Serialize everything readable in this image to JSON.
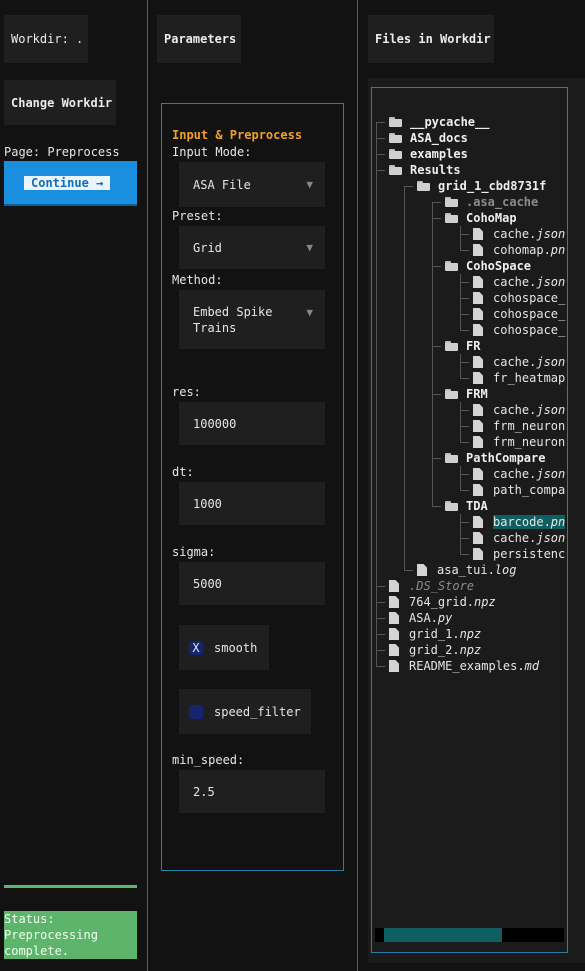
{
  "left": {
    "workdir_label": "Workdir: .",
    "change_workdir": "Change Workdir",
    "page_label": "Page: Preprocess",
    "continue_button": "Continue →",
    "status_text": "Status: Preprocessing complete."
  },
  "params": {
    "header": "Parameters",
    "section_title": "Input & Preprocess",
    "input_mode_label": "Input Mode:",
    "input_mode_value": "ASA File",
    "preset_label": "Preset:",
    "preset_value": "Grid",
    "method_label": "Method:",
    "method_value": "Embed Spike Trains",
    "res_label": "res:",
    "res_value": "100000",
    "dt_label": "dt:",
    "dt_value": "1000",
    "sigma_label": "sigma:",
    "sigma_value": "5000",
    "smooth_label": "smooth",
    "smooth_mark": "X",
    "smooth_checked": true,
    "speed_filter_label": "speed_filter",
    "speed_filter_checked": false,
    "min_speed_label": "min_speed:",
    "min_speed_value": "2.5"
  },
  "files": {
    "header": "Files in Workdir",
    "tree": [
      {
        "name": "__pycache__",
        "ext": "",
        "type": "folder"
      },
      {
        "name": "ASA_docs",
        "ext": "",
        "type": "folder"
      },
      {
        "name": "examples",
        "ext": "",
        "type": "folder"
      },
      {
        "name": "Results",
        "ext": "",
        "type": "folder"
      },
      {
        "name": "grid_1_cbd8731f",
        "ext": "",
        "type": "folder"
      },
      {
        "name": ".asa_cache",
        "ext": "",
        "type": "folder"
      },
      {
        "name": "CohoMap",
        "ext": "",
        "type": "folder"
      },
      {
        "name": "cache.",
        "ext": "json",
        "type": "file"
      },
      {
        "name": "cohomap.",
        "ext": "pn",
        "type": "file"
      },
      {
        "name": "CohoSpace",
        "ext": "",
        "type": "folder"
      },
      {
        "name": "cache.",
        "ext": "json",
        "type": "file"
      },
      {
        "name": "cohospace_",
        "ext": "",
        "type": "file"
      },
      {
        "name": "cohospace_",
        "ext": "",
        "type": "file"
      },
      {
        "name": "cohospace_",
        "ext": "",
        "type": "file"
      },
      {
        "name": "FR",
        "ext": "",
        "type": "folder"
      },
      {
        "name": "cache.",
        "ext": "json",
        "type": "file"
      },
      {
        "name": "fr_heatmap",
        "ext": "",
        "type": "file"
      },
      {
        "name": "FRM",
        "ext": "",
        "type": "folder"
      },
      {
        "name": "cache.",
        "ext": "json",
        "type": "file"
      },
      {
        "name": "frm_neuron",
        "ext": "",
        "type": "file"
      },
      {
        "name": "frm_neuron",
        "ext": "",
        "type": "file"
      },
      {
        "name": "PathCompare",
        "ext": "",
        "type": "folder"
      },
      {
        "name": "cache.",
        "ext": "json",
        "type": "file"
      },
      {
        "name": "path_compa",
        "ext": "",
        "type": "file"
      },
      {
        "name": "TDA",
        "ext": "",
        "type": "folder"
      },
      {
        "name": "barcode.",
        "ext": "pn",
        "type": "file"
      },
      {
        "name": "cache.",
        "ext": "json",
        "type": "file"
      },
      {
        "name": "persistenc",
        "ext": "",
        "type": "file"
      },
      {
        "name": "asa_tui.",
        "ext": "log",
        "type": "file"
      },
      {
        "name": ".DS_Store",
        "ext": "",
        "type": "file"
      },
      {
        "name": "764_grid.",
        "ext": "npz",
        "type": "file"
      },
      {
        "name": "ASA.",
        "ext": "py",
        "type": "file"
      },
      {
        "name": "grid_1.",
        "ext": "npz",
        "type": "file"
      },
      {
        "name": "grid_2.",
        "ext": "npz",
        "type": "file"
      },
      {
        "name": "README_examples.",
        "ext": "md",
        "type": "file"
      }
    ]
  },
  "colors": {
    "accent_blue": "#1a8fe0",
    "status_green": "#5cb56a",
    "section_orange": "#f0a020",
    "selection_teal": "#0f5f62"
  }
}
